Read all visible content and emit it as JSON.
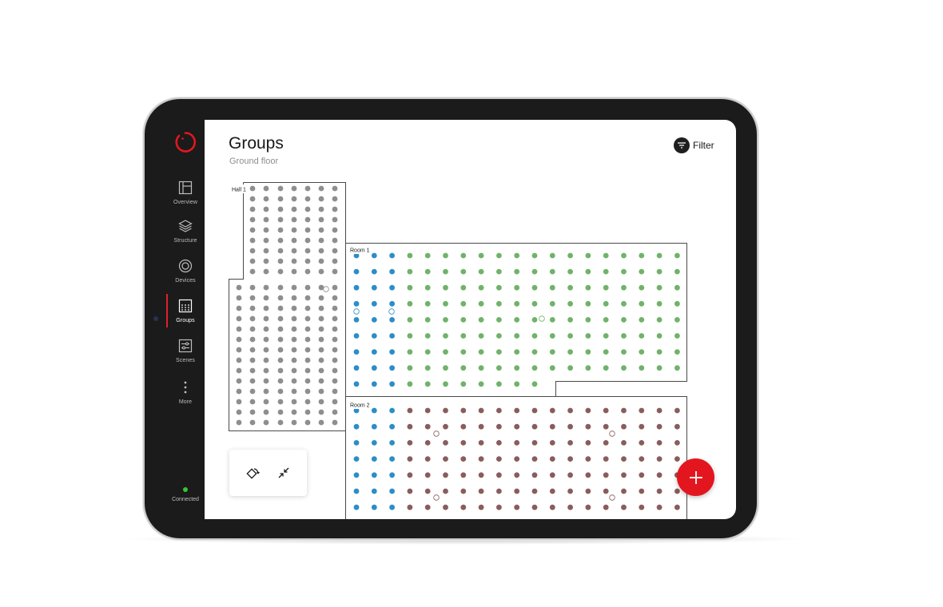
{
  "header": {
    "title": "Groups",
    "subtitle": "Ground floor",
    "filter_label": "Filter"
  },
  "sidebar": {
    "items": [
      {
        "label": "Overview",
        "icon": "overview-icon"
      },
      {
        "label": "Structure",
        "icon": "layers-icon"
      },
      {
        "label": "Devices",
        "icon": "device-icon"
      },
      {
        "label": "Groups",
        "icon": "groups-icon",
        "active": true
      },
      {
        "label": "Scenes",
        "icon": "sliders-icon"
      },
      {
        "label": "More",
        "icon": "more-icon"
      }
    ],
    "status": {
      "label": "Connected",
      "color": "#38c43a"
    }
  },
  "rooms": [
    {
      "label": "Hall 1"
    },
    {
      "label": "Room 1"
    },
    {
      "label": "Room 2"
    }
  ],
  "colors": {
    "accent": "#e3161f",
    "hall_devices": "#8e8e8e",
    "blue_group": "#2b8ec7",
    "green_group": "#6fb36a",
    "brown_group": "#8a5c5c",
    "walls": "#4a4a4a"
  },
  "tools": [
    {
      "icon": "rotate-icon"
    },
    {
      "icon": "collapse-icon"
    }
  ],
  "fab": {
    "icon": "plus-icon"
  }
}
